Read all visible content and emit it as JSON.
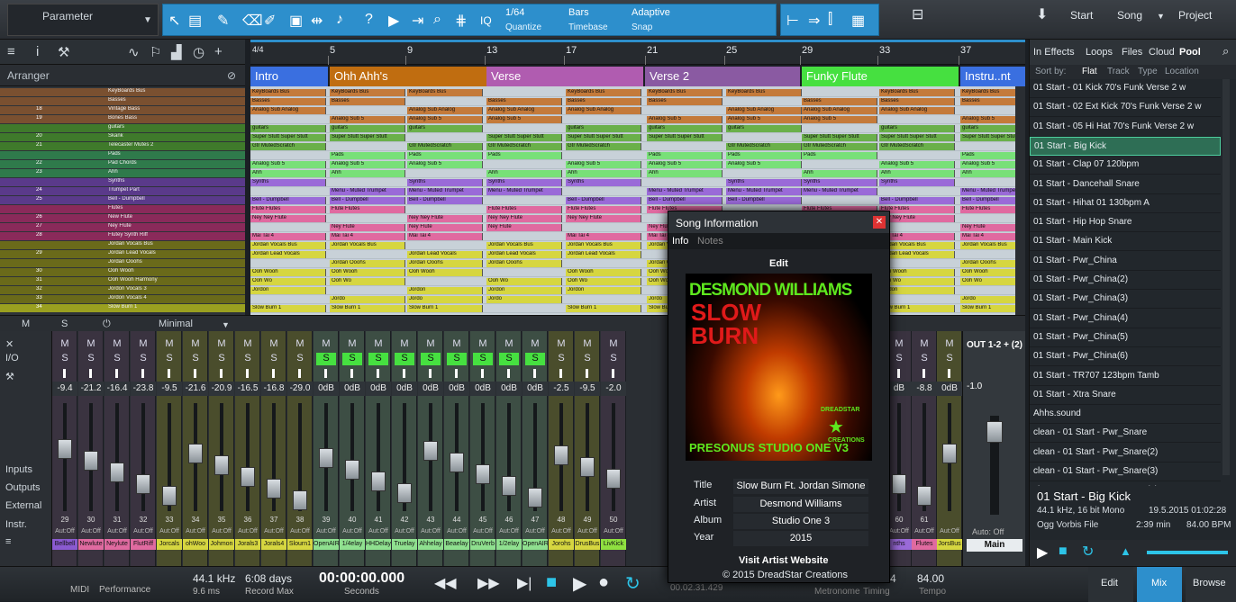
{
  "toolbar": {
    "parameter_label": "Parameter",
    "quantize_value": "1/64",
    "quantize_label": "Quantize",
    "timebase_value": "Bars",
    "timebase_label": "Timebase",
    "snap_value": "Adaptive",
    "snap_label": "Snap",
    "iq_label": "IQ",
    "start_label": "Start",
    "song_label": "Song",
    "project_label": "Project"
  },
  "ruler": {
    "bars": [
      "5",
      "9",
      "13",
      "17",
      "21",
      "25",
      "29",
      "33",
      "37"
    ],
    "signature": "4/4"
  },
  "arranger": {
    "title": "Arranger",
    "sections": [
      {
        "name": "Intro",
        "color": "#3a6fe0"
      },
      {
        "name": "Ohh Ahh's",
        "color": "#c06d10"
      },
      {
        "name": "Verse",
        "color": "#b05cb0"
      },
      {
        "name": "Verse 2",
        "color": "#8a5aa2"
      },
      {
        "name": "Funky Flute",
        "color": "#46e040"
      },
      {
        "name": "Instru..nt",
        "color": "#3a6fe0"
      }
    ]
  },
  "tracks": [
    {
      "num": "",
      "name": "KeyBoards Bus",
      "color": "#7a5030"
    },
    {
      "num": "",
      "name": "Basses",
      "color": "#7a5030"
    },
    {
      "num": "18",
      "name": "Vintage Bass",
      "color": "#7a5030"
    },
    {
      "num": "19",
      "name": "Bones Bass",
      "color": "#7a5030"
    },
    {
      "num": "",
      "name": "guitars",
      "color": "#3f7a2b"
    },
    {
      "num": "20",
      "name": "Skank",
      "color": "#3f7a2b"
    },
    {
      "num": "21",
      "name": "Telecaster Mutes 2",
      "color": "#3f7a2b"
    },
    {
      "num": "",
      "name": "Pads",
      "color": "#2f7a4b"
    },
    {
      "num": "22",
      "name": "Pad Chords",
      "color": "#2f7a4b"
    },
    {
      "num": "23",
      "name": "Ahh",
      "color": "#2f7a4b"
    },
    {
      "num": "",
      "name": "Synths",
      "color": "#5a3a8a"
    },
    {
      "num": "24",
      "name": "Trumpet Part",
      "color": "#5a3a8a"
    },
    {
      "num": "25",
      "name": "Bell - Dumpbell",
      "color": "#5a3a8a"
    },
    {
      "num": "",
      "name": "Flutes",
      "color": "#8a2a5a"
    },
    {
      "num": "26",
      "name": "New Flute",
      "color": "#8a2a5a"
    },
    {
      "num": "27",
      "name": "Ney Flute",
      "color": "#8a2a5a"
    },
    {
      "num": "28",
      "name": "Flutey Synth Riff",
      "color": "#8a2a5a"
    },
    {
      "num": "",
      "name": "Jordan Vocals Bus",
      "color": "#6a6a1a"
    },
    {
      "num": "29",
      "name": "Jordan Lead Vocals",
      "color": "#6a6a1a"
    },
    {
      "num": "",
      "name": "Jordan Ooohs",
      "color": "#6a6a1a"
    },
    {
      "num": "30",
      "name": "Ooh Wooh",
      "color": "#6a6a1a"
    },
    {
      "num": "31",
      "name": "Ooh Wooh Harmony",
      "color": "#6a6a1a"
    },
    {
      "num": "32",
      "name": "Jordon Vocals 3",
      "color": "#6a6a1a"
    },
    {
      "num": "33",
      "name": "Jordon Vocals 4",
      "color": "#6a6a1a"
    },
    {
      "num": "34",
      "name": "Slow Burn 1",
      "color": "#9aa020"
    }
  ],
  "clips": [
    {
      "lane": 0,
      "name": "KeyBoards Bus",
      "color": "#c47a3a"
    },
    {
      "lane": 1,
      "name": "Basses",
      "color": "#c47a3a"
    },
    {
      "lane": 2,
      "name": "Analog Sub Analog",
      "color": "#c47a3a"
    },
    {
      "lane": 3,
      "name": "Analog Sub 5",
      "color": "#c47a3a"
    },
    {
      "lane": 4,
      "name": "guitars",
      "color": "#6ab04a"
    },
    {
      "lane": 5,
      "name": "Super Stutt Super Stutt",
      "color": "#6ab04a"
    },
    {
      "lane": 6,
      "name": "Gtr MutedScratch",
      "color": "#6ab04a"
    },
    {
      "lane": 7,
      "name": "Pads",
      "color": "#78e078"
    },
    {
      "lane": 8,
      "name": "Analog Sub 5",
      "color": "#78e078"
    },
    {
      "lane": 9,
      "name": "Ahh",
      "color": "#78e078"
    },
    {
      "lane": 10,
      "name": "Synths",
      "color": "#9a6ad8"
    },
    {
      "lane": 11,
      "name": "Menu - Muted Trumpet",
      "color": "#9a6ad8"
    },
    {
      "lane": 12,
      "name": "Bell - Dumpbell",
      "color": "#9a6ad8"
    },
    {
      "lane": 13,
      "name": "Flute Flutes",
      "color": "#e06aa0"
    },
    {
      "lane": 14,
      "name": "Ney Ney Flute",
      "color": "#e06aa0"
    },
    {
      "lane": 15,
      "name": "Ney Flute",
      "color": "#e06aa0"
    },
    {
      "lane": 16,
      "name": "Mai Tai 4",
      "color": "#e06aa0"
    },
    {
      "lane": 17,
      "name": "Jordan Vocals Bus",
      "color": "#d6d640"
    },
    {
      "lane": 18,
      "name": "Jordan Lead Vocals",
      "color": "#d6d640"
    },
    {
      "lane": 19,
      "name": "Jordan Ooohs",
      "color": "#d6d640"
    },
    {
      "lane": 20,
      "name": "Ooh Wooh",
      "color": "#d6d640"
    },
    {
      "lane": 21,
      "name": "Ooh Wo",
      "color": "#d6d640"
    },
    {
      "lane": 22,
      "name": "Jordon",
      "color": "#d6d640"
    },
    {
      "lane": 23,
      "name": "Jordo",
      "color": "#d6d640"
    },
    {
      "lane": 24,
      "name": "Slow Burn 1",
      "color": "#d6d640"
    }
  ],
  "mixer": {
    "mode_label": "Minimal",
    "io_label": "I/O",
    "inputs_label": "Inputs",
    "outputs_label": "Outputs",
    "external_label": "External",
    "instr_label": "Instr.",
    "out_label": "OUT 1-2 + (2)",
    "main_label": "Main",
    "auto_off": "Auto: Off",
    "channels": [
      {
        "db": "-9.4",
        "num": "29",
        "label": "Bellbell",
        "color": "#8a5ad0"
      },
      {
        "db": "-21.2",
        "num": "30",
        "label": "Newlute",
        "color": "#e06aa0"
      },
      {
        "db": "-16.4",
        "num": "31",
        "label": "Neylute",
        "color": "#e06aa0"
      },
      {
        "db": "-23.8",
        "num": "32",
        "label": "FlutRiff",
        "color": "#e06aa0"
      },
      {
        "db": "-9.5",
        "num": "33",
        "label": "Jorcals",
        "color": "#d6d640"
      },
      {
        "db": "-21.6",
        "num": "34",
        "label": "ohWoo",
        "color": "#d6d640"
      },
      {
        "db": "-20.9",
        "num": "35",
        "label": "Johmon",
        "color": "#d6d640"
      },
      {
        "db": "-16.5",
        "num": "36",
        "label": "Jorals3",
        "color": "#d6d640"
      },
      {
        "db": "-16.8",
        "num": "37",
        "label": "Jorals4",
        "color": "#d6d640"
      },
      {
        "db": "-29.0",
        "num": "38",
        "label": "Slourn1",
        "color": "#d6d640"
      },
      {
        "db": "0dB",
        "num": "39",
        "label": "OpenAIR",
        "color": "#8fe08f"
      },
      {
        "db": "0dB",
        "num": "40",
        "label": "1/4elay",
        "color": "#8fe08f"
      },
      {
        "db": "0dB",
        "num": "41",
        "label": "HHDelay",
        "color": "#8fe08f"
      },
      {
        "db": "0dB",
        "num": "42",
        "label": "Truelay",
        "color": "#8fe08f"
      },
      {
        "db": "0dB",
        "num": "43",
        "label": "Ahhelay",
        "color": "#8fe08f"
      },
      {
        "db": "0dB",
        "num": "44",
        "label": "Beaelay",
        "color": "#8fe08f"
      },
      {
        "db": "0dB",
        "num": "45",
        "label": "DruVerb",
        "color": "#8fe08f"
      },
      {
        "db": "0dB",
        "num": "46",
        "label": "1/2elay",
        "color": "#8fe08f"
      },
      {
        "db": "0dB",
        "num": "47",
        "label": "OpenAIR",
        "color": "#8fe08f"
      },
      {
        "db": "-2.5",
        "num": "48",
        "label": "Jorohs",
        "color": "#d6d640"
      },
      {
        "db": "-9.5",
        "num": "49",
        "label": "DrusBus",
        "color": "#d6d640"
      },
      {
        "db": "-2.0",
        "num": "50",
        "label": "LivKick",
        "color": "#8fe040"
      }
    ],
    "right_channels": [
      {
        "db": "dB",
        "num": "60",
        "label": "nths",
        "color": "#9a6ad8"
      },
      {
        "db": "-8.8",
        "num": "61",
        "label": "Flutes",
        "color": "#e06aa0"
      },
      {
        "db": "0dB",
        "num": "",
        "label": "JorsBus",
        "color": "#d6d640"
      }
    ],
    "out_db": "-1.0"
  },
  "browser": {
    "tabs": [
      "In Effects",
      "Loops",
      "Files",
      "Cloud",
      "Pool"
    ],
    "sort_label": "Sort by:",
    "sort_options": [
      "Flat",
      "Track",
      "Type",
      "Location"
    ],
    "items": [
      "01 Start - 01 Kick 70's Funk Verse 2 w",
      "01 Start - 02 Ext Kick 70's Funk Verse 2 w",
      "01 Start - 05 Hi Hat 70's Funk Verse 2 w",
      "01 Start - Big Kick",
      "01 Start - Clap 07 120bpm",
      "01 Start - Dancehall Snare",
      "01 Start - Hihat 01 130bpm A",
      "01 Start - Hip Hop Snare",
      "01 Start - Main Kick",
      "01 Start - Pwr_China",
      "01 Start - Pwr_China(2)",
      "01 Start - Pwr_China(3)",
      "01 Start - Pwr_China(4)",
      "01 Start - Pwr_China(5)",
      "01 Start - Pwr_China(6)",
      "01 Start - TR707 123bpm Tamb",
      "01 Start - Xtra Snare",
      "Ahhs.sound",
      "clean - 01 Start - Pwr_Snare",
      "clean - 01 Start - Pwr_Snare(2)",
      "clean - 01 Start - Pwr_Snare(3)",
      "clean - 01 Start - Pwr_Snare(4)"
    ],
    "selected_index": 3,
    "info_title": "01 Start - Big Kick",
    "info_format": "44.1 kHz, 16 bit Mono",
    "info_date": "19.5.2015 01:02:28",
    "info_type": "Ogg Vorbis File",
    "info_length": "2:39 min",
    "info_bpm": "84.00 BPM"
  },
  "dialog": {
    "title": "Song Information",
    "tab_info": "Info",
    "tab_notes": "Notes",
    "edit_label": "Edit",
    "cover_artist": "DESMOND WILLIAMS",
    "cover_title1": "SLOW",
    "cover_title2": "BURN",
    "cover_footer": "PRESONUS STUDIO ONE V3",
    "cover_brand": "DREADSTAR",
    "cover_brand2": "CREATIONS",
    "title_label": "Title",
    "title_value": "Slow Burn Ft. Jordan Simone",
    "artist_label": "Artist",
    "artist_value": "Desmond Williams",
    "album_label": "Album",
    "album_value": "Studio One 3",
    "year_label": "Year",
    "year_value": "2015",
    "website_label": "Visit Artist Website",
    "copyright": "© 2015 DreadStar Creations"
  },
  "transport": {
    "midi_label": "MIDI",
    "performance_label": "Performance",
    "sample_rate": "44.1 kHz",
    "latency": "9.6 ms",
    "record_days": "6:08 days",
    "record_max_label": "Record Max",
    "time": "00:00:00.000",
    "seconds_label": "Seconds",
    "position": "00.02.31.429",
    "metronome_label": "Metronome",
    "timing_label": "Timing",
    "tempo_value": "84.00",
    "tempo_label": "Tempo",
    "sig_value": "4",
    "edit_label": "Edit",
    "mix_label": "Mix",
    "browse_label": "Browse"
  }
}
